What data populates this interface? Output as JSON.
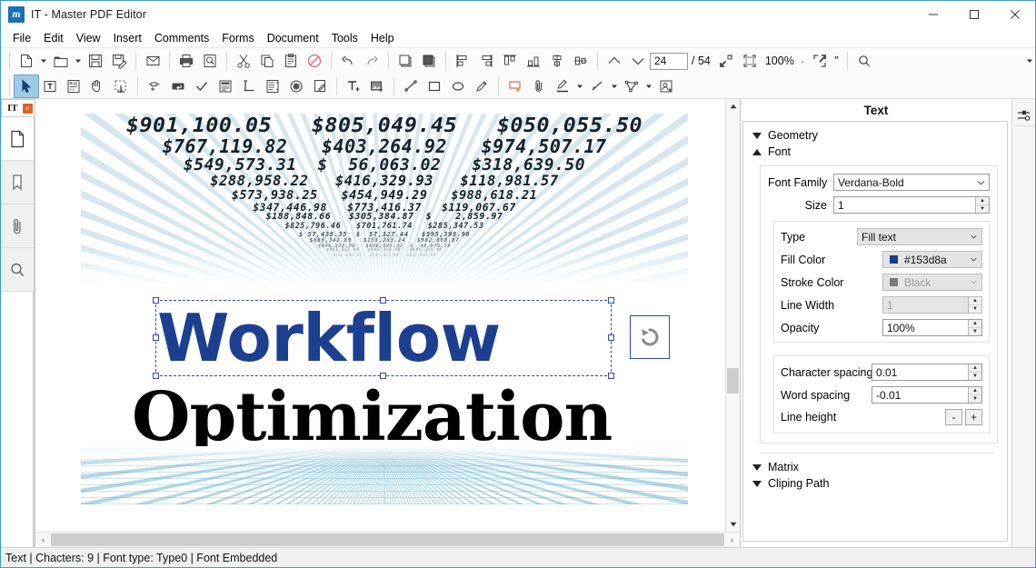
{
  "window": {
    "title": "IT - Master PDF Editor",
    "app_icon": "master-pdf-editor-logo",
    "minimize": "–",
    "maximize": "☐",
    "close": "✕"
  },
  "menubar": {
    "items": [
      {
        "label": "File"
      },
      {
        "label": "Edit"
      },
      {
        "label": "View"
      },
      {
        "label": "Insert"
      },
      {
        "label": "Comments"
      },
      {
        "label": "Forms"
      },
      {
        "label": "Document"
      },
      {
        "label": "Tools"
      },
      {
        "label": "Help"
      }
    ]
  },
  "toolbar_main": {
    "buttons": [
      {
        "name": "new-document-icon",
        "title": "New"
      },
      {
        "name": "new-document-dropdown-icon",
        "title": "New options"
      },
      {
        "name": "open-folder-icon",
        "title": "Open"
      },
      {
        "name": "open-dropdown-icon",
        "title": "Open options"
      },
      {
        "name": "save-icon",
        "title": "Save"
      },
      {
        "name": "save-as-icon",
        "title": "Save As"
      },
      {
        "name": "email-icon",
        "title": "Email"
      },
      {
        "name": "print-icon",
        "title": "Print"
      },
      {
        "name": "print-preview-icon",
        "title": "Print Preview"
      },
      {
        "name": "cut-icon",
        "title": "Cut"
      },
      {
        "name": "copy-icon",
        "title": "Copy"
      },
      {
        "name": "paste-icon",
        "title": "Paste"
      },
      {
        "name": "delete-icon",
        "title": "Delete"
      },
      {
        "name": "undo-icon",
        "title": "Undo"
      },
      {
        "name": "redo-icon",
        "title": "Redo"
      },
      {
        "name": "bring-to-front-icon",
        "title": "Bring to Front"
      },
      {
        "name": "send-to-back-icon",
        "title": "Send to Back"
      },
      {
        "name": "align-left-icon",
        "title": "Align Left"
      },
      {
        "name": "align-right-icon",
        "title": "Align Right"
      },
      {
        "name": "align-top-icon",
        "title": "Align Top"
      },
      {
        "name": "align-bottom-icon",
        "title": "Align Bottom"
      },
      {
        "name": "align-center-vertical-icon",
        "title": "Center Vertically"
      },
      {
        "name": "align-center-horizontal-icon",
        "title": "Center Horizontally"
      },
      {
        "name": "previous-page-icon",
        "title": "Previous Page"
      },
      {
        "name": "next-page-icon",
        "title": "Next Page"
      }
    ],
    "page_number": "24",
    "page_total": "/ 54",
    "zoom_level": "100%",
    "zoom_out_icon": "zoom-fit-page-icon",
    "zoom_fit_icon": "zoom-fit-width-icon",
    "zoom_separator": "·",
    "fullscreen_icon": "fullscreen-icon",
    "quote_label": "”",
    "search_icon": "search-icon",
    "overflow_icon": "toolbar-overflow-icon"
  },
  "toolbar_tools": {
    "buttons": [
      {
        "name": "select-tool-icon",
        "title": "Select",
        "selected": true
      },
      {
        "name": "edit-text-icon",
        "title": "Edit Text"
      },
      {
        "name": "edit-object-icon",
        "title": "Edit Object"
      },
      {
        "name": "hand-tool-icon",
        "title": "Hand Tool"
      },
      {
        "name": "snapshot-icon",
        "title": "Snapshot"
      },
      {
        "name": "link-icon",
        "title": "Add Link"
      },
      {
        "name": "text-field-icon",
        "title": "Text Field"
      },
      {
        "name": "checkbox-field-icon",
        "title": "Check Box"
      },
      {
        "name": "list-box-icon",
        "title": "List Box"
      },
      {
        "name": "signature-field-icon",
        "title": "Signature Field"
      },
      {
        "name": "combo-box-icon",
        "title": "Combo Box"
      },
      {
        "name": "radio-button-icon",
        "title": "Radio Button"
      },
      {
        "name": "note-icon",
        "title": "Sticky Note"
      },
      {
        "name": "add-text-icon",
        "title": "Add Text"
      },
      {
        "name": "add-image-icon",
        "title": "Add Image"
      },
      {
        "name": "line-icon",
        "title": "Line"
      },
      {
        "name": "rectangle-icon",
        "title": "Rectangle"
      },
      {
        "name": "ellipse-icon",
        "title": "Ellipse"
      },
      {
        "name": "pencil-icon",
        "title": "Pencil"
      },
      {
        "name": "text-box-icon",
        "title": "Text Box"
      },
      {
        "name": "attachment-icon",
        "title": "Attach File"
      },
      {
        "name": "highlight-icon",
        "title": "Highlight"
      },
      {
        "name": "highlight-dropdown-icon",
        "title": "Highlight options"
      },
      {
        "name": "arrow-icon",
        "title": "Arrow"
      },
      {
        "name": "arrow-dropdown-icon",
        "title": "Arrow options"
      },
      {
        "name": "polygon-icon",
        "title": "Polygon"
      },
      {
        "name": "polygon-dropdown-icon",
        "title": "Polygon options"
      },
      {
        "name": "stamp-icon",
        "title": "Stamp"
      }
    ]
  },
  "document_tab": {
    "label": "IT",
    "close_label": "×"
  },
  "sidebar": {
    "items": [
      {
        "name": "pages-panel-icon",
        "label": "Pages",
        "active": true
      },
      {
        "name": "bookmarks-panel-icon",
        "label": "Bookmarks",
        "active": false
      },
      {
        "name": "attachments-panel-icon",
        "label": "Attachments",
        "active": false
      },
      {
        "name": "search-panel-icon",
        "label": "Search",
        "active": false
      }
    ]
  },
  "document": {
    "vortex_rows": [
      "$901,100.05   $805,049.45   $050,055.50",
      "$767,119.82   $403,264.92   $974,507.17",
      "$549,573.31  $  56,063.02   $318,639.50",
      "$288,958.22   $416,329.93   $118,981.57",
      "$573,938.25   $454,949.29   $988,618.21",
      "$347,446.98   $773,416.37   $119,067.67",
      "$188,848.66   $305,384.87  $    2,859.97",
      "$825,796.46   $701,761.74   $285,347.53",
      "$ 57,438.35  $  57,327.44   $595,398.90",
      "$686,342.89   $153,283.24   $982,888.87",
      "$946,328.96   $686,543.32  $  44,876.38",
      "$901,552.40   $666,318.40   $646,318.98",
      "$953,846.81   $191,813.88   $522,893.89"
    ],
    "headline_1": "Workflow",
    "headline_2": "Optimization",
    "rotate_handle_icon": "rotate-icon"
  },
  "properties_panel": {
    "title": "Text",
    "sections": {
      "geometry": {
        "label": "Geometry",
        "expanded": false
      },
      "font": {
        "label": "Font",
        "expanded": true
      },
      "matrix": {
        "label": "Matrix",
        "expanded": false
      },
      "clipping_path": {
        "label": "Cliping Path",
        "expanded": false
      }
    },
    "fields": {
      "font_family_label": "Font Family",
      "font_family_value": "Verdana-Bold",
      "size_label": "Size",
      "size_value": "1",
      "type_label": "Type",
      "type_value": "Fill text",
      "fill_color_label": "Fill Color",
      "fill_color_value": "#153d8a",
      "fill_color_hex": "#153d8a",
      "stroke_color_label": "Stroke Color",
      "stroke_color_value": "Black",
      "stroke_color_hex": "#7a7a7a",
      "line_width_label": "Line Width",
      "line_width_value": "1",
      "opacity_label": "Opacity",
      "opacity_value": "100%",
      "character_spacing_label": "Character spacing",
      "character_spacing_value": "0.01",
      "word_spacing_label": "Word spacing",
      "word_spacing_value": "-0.01",
      "line_height_label": "Line height",
      "line_height_minus": "-",
      "line_height_plus": "+"
    },
    "side_buttons": [
      {
        "name": "properties-sliders-icon",
        "label": "Properties"
      }
    ]
  },
  "scrollbars": {
    "up_arrow": "▲",
    "down_arrow": "▼",
    "left_arrow": "‹",
    "right_arrow": "›"
  },
  "statusbar": {
    "text": "Text | Chacters: 9 | Font type: Type0 | Font Embedded"
  },
  "colors": {
    "accent": "#3c9ad8",
    "selection": "#2d46b8",
    "headline_blue": "#1d3f8f",
    "tab_close": "#d9622b"
  }
}
